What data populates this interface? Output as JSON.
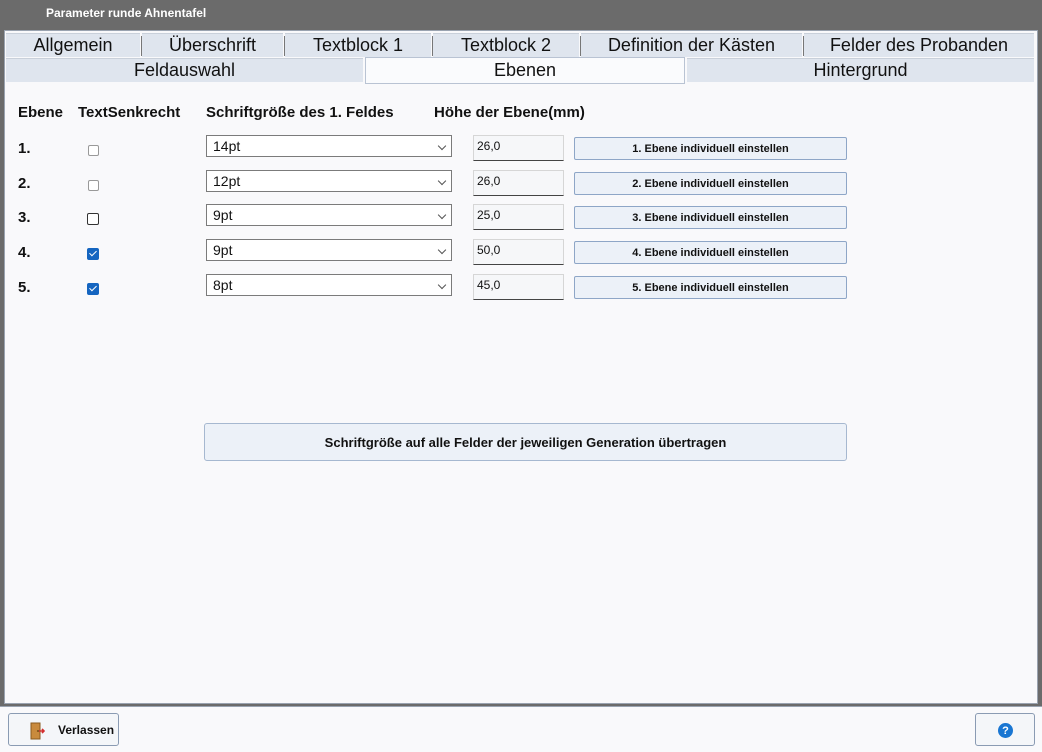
{
  "window": {
    "title": "Parameter runde Ahnentafel"
  },
  "tabs_row1": [
    "Allgemein",
    "Überschrift",
    "Textblock 1",
    "Textblock 2",
    "Definition der Kästen",
    "Felder des Probanden"
  ],
  "tabs_row2": [
    "Feldauswahl",
    "Ebenen",
    "Hintergrund"
  ],
  "active_tab": "Ebenen",
  "headers": {
    "ebene": "Ebene",
    "text_senkrecht": "TextSenkrecht",
    "schriftgroesse": "Schriftgröße des 1. Feldes",
    "hoehe": "Höhe der Ebene(mm)"
  },
  "rows": [
    {
      "num": "1.",
      "checked": false,
      "enabled": false,
      "font_size": "14pt",
      "height": "26,0",
      "button": "1. Ebene individuell einstellen"
    },
    {
      "num": "2.",
      "checked": false,
      "enabled": false,
      "font_size": "12pt",
      "height": "26,0",
      "button": "2. Ebene individuell einstellen"
    },
    {
      "num": "3.",
      "checked": false,
      "enabled": true,
      "font_size": "9pt",
      "height": "25,0",
      "button": "3. Ebene individuell einstellen"
    },
    {
      "num": "4.",
      "checked": true,
      "enabled": true,
      "font_size": "9pt",
      "height": "50,0",
      "button": "4. Ebene individuell einstellen"
    },
    {
      "num": "5.",
      "checked": true,
      "enabled": true,
      "font_size": "8pt",
      "height": "45,0",
      "button": "5. Ebene individuell einstellen"
    }
  ],
  "apply_button": "Schriftgröße auf alle Felder der jeweiligen Generation übertragen",
  "footer": {
    "exit_label": "Verlassen",
    "exit_icon": "exit-door-icon",
    "help_icon": "help-icon"
  },
  "colors": {
    "accent": "#1565c0",
    "button_bg": "#ecf1f8",
    "tab_bg": "#dfe5ee"
  }
}
